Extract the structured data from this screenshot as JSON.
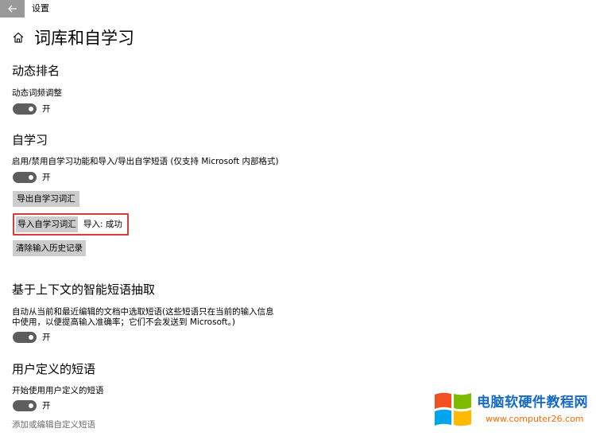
{
  "window": {
    "title": "设置",
    "back_icon": "arrow-left-icon"
  },
  "header": {
    "home_icon": "home-icon",
    "title": "词库和自学习"
  },
  "sections": {
    "dynamic_ranking": {
      "title": "动态排名",
      "setting_label": "动态词频调整",
      "toggle_state": "开"
    },
    "self_learning": {
      "title": "自学习",
      "setting_label": "启用/禁用自学习功能和导入/导出自学短语 (仅支持 Microsoft 内部格式)",
      "toggle_state": "开",
      "export_button": "导出自学习词汇",
      "import_button": "导入自学习词汇",
      "import_status": "导入: 成功",
      "clear_button": "清除输入历史记录"
    },
    "context_phrases": {
      "title": "基于上下文的智能短语抽取",
      "description_line1": "自动从当前和最近编辑的文档中选取短语(这些短语只在当前的输入信息",
      "description_line2": "中使用，以便提高输入准确率；它们不会发送到 Microsoft。)",
      "toggle_state": "开"
    },
    "user_phrases": {
      "title": "用户定义的短语",
      "setting_label": "开始使用用户定义的短语",
      "toggle_state": "开",
      "link": "添加或编辑自定义短语"
    }
  },
  "watermark": {
    "name": "电脑软硬件教程网",
    "url": "www.computer26.com",
    "colors": [
      "#f25022",
      "#7fba00",
      "#00a4ef",
      "#ffb900"
    ]
  },
  "colors": {
    "toggle_on": "#5d5d5d",
    "button_bg": "#cccccc",
    "highlight_border": "#d93a3a",
    "back_button_bg": "#999999"
  }
}
